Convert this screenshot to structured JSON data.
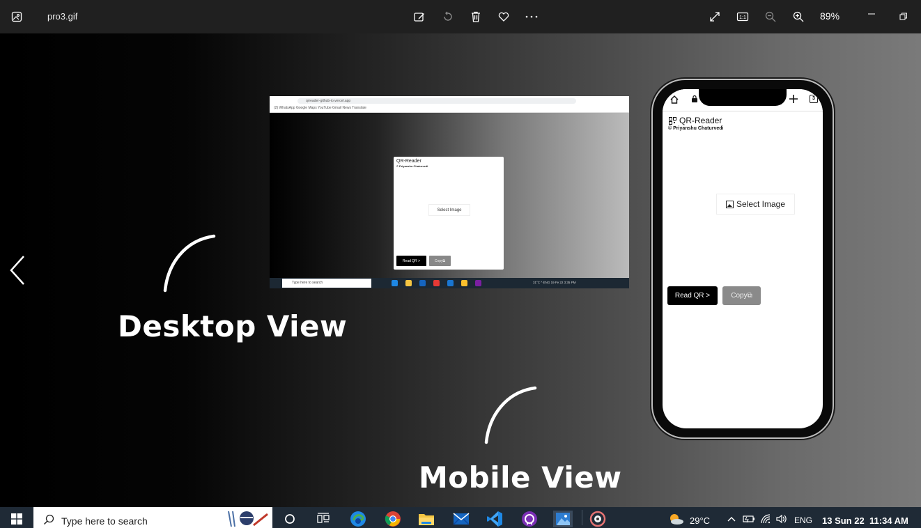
{
  "titlebar": {
    "filename": "pro3.gif",
    "zoom_level": "89%",
    "zoom_one_to_one": "1:1",
    "actions": [
      "edit-icon",
      "rotate-icon",
      "delete-icon",
      "favorite-icon",
      "more-icon",
      "fullscreen-icon",
      "actual-size-icon",
      "zoom-out-icon",
      "zoom-in-icon"
    ]
  },
  "slide": {
    "desktop_label": "Desktop View",
    "mobile_label": "Mobile View",
    "desktop_screenshot": {
      "url": "qrreader-github-io.vercel.app",
      "bookmarks": "(2) WhatsApp   Google   Maps   YouTube   Gmail   News   Translate",
      "card_title": "QR-Reader",
      "card_subtitle": "© Priyanshu Chaturvedi",
      "select_label": "Select Image",
      "read_label": "Read QR >",
      "copy_label": "Copy⧉",
      "search_placeholder": "Type here to search",
      "tray": "31°C  ^  ENG   19 Fe 22  3:35 PM"
    },
    "mobile_screenshot": {
      "tab_count": "3",
      "app_title": "QR-Reader",
      "app_subtitle": "© Priyanshu Chaturvedi",
      "select_label": "Select Image",
      "read_label": "Read QR >",
      "copy_label": "Copy⧉"
    }
  },
  "taskbar": {
    "search_placeholder": "Type here to search",
    "apps": [
      "cortana-icon",
      "task-view-icon",
      "edge-icon",
      "chrome-icon",
      "file-explorer-icon",
      "mail-icon",
      "vscode-icon",
      "github-desktop-icon",
      "photos-icon",
      "media-player-icon"
    ],
    "weather": "29°C",
    "language": "ENG",
    "date": "13 Sun 22",
    "time": "11:34 AM"
  },
  "colors": {
    "titlebar": "#202020",
    "taskbar": "#1f2a36",
    "accent": "#7aa7d8"
  }
}
